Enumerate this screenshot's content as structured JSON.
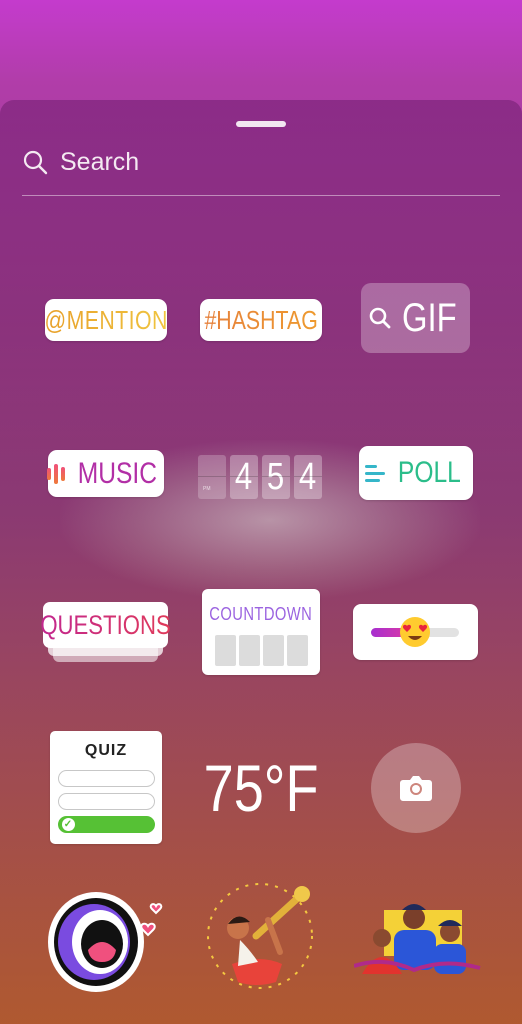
{
  "search": {
    "label": "Search",
    "icon": "search-icon"
  },
  "stickers": {
    "mention": "@MENTION",
    "hashtag": "#HASHTAG",
    "gif": "GIF",
    "music": "MUSIC",
    "clock": {
      "digits": [
        "",
        "4",
        "5",
        "4"
      ],
      "am_pm": "PM"
    },
    "poll": "POLL",
    "questions": "QUESTIONS",
    "countdown": "COUNTDOWN",
    "slider_emoji": "heart-eyes-emoji",
    "quiz": "QUIZ",
    "temperature": "75°F",
    "camera": "camera-icon"
  },
  "colors": {
    "mention": "#e8a02a",
    "hashtag": "#e6813c",
    "music": "#b22fa6",
    "poll": "#2bbd8a",
    "questions": "#c2278f",
    "countdown": "#9b63e0",
    "quiz_correct": "#56c135"
  }
}
